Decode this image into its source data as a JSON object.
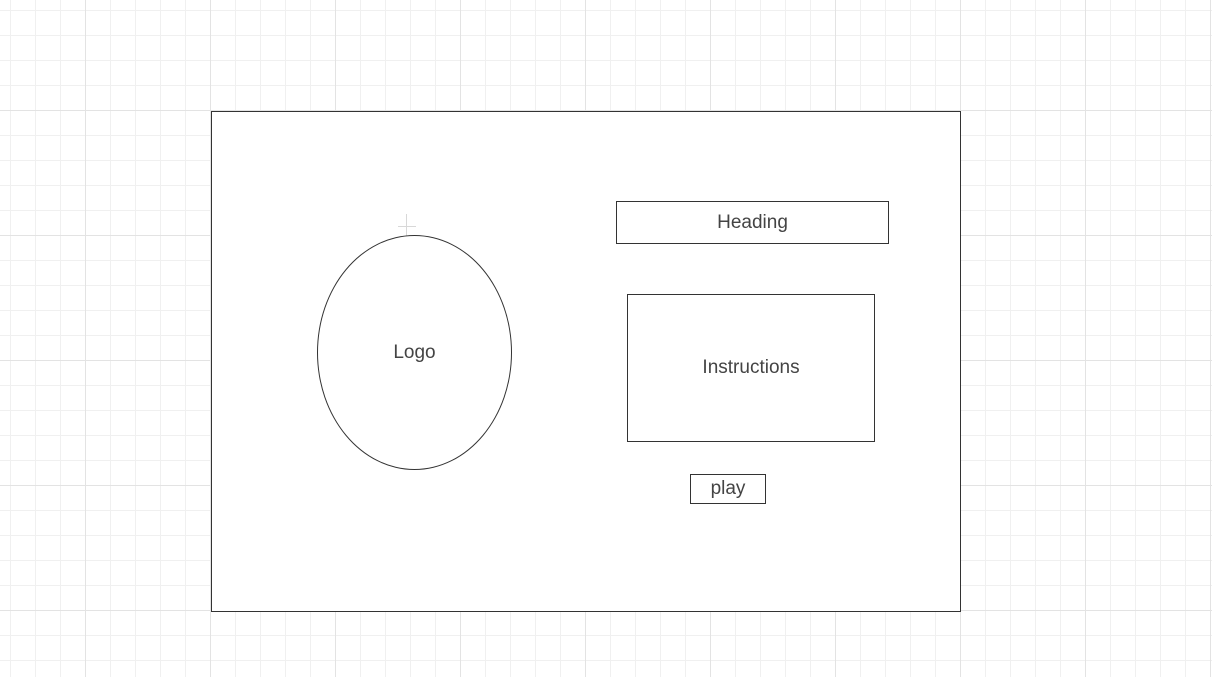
{
  "wireframe": {
    "logo_label": "Logo",
    "heading_label": "Heading",
    "instructions_label": "Instructions",
    "play_label": "play"
  }
}
